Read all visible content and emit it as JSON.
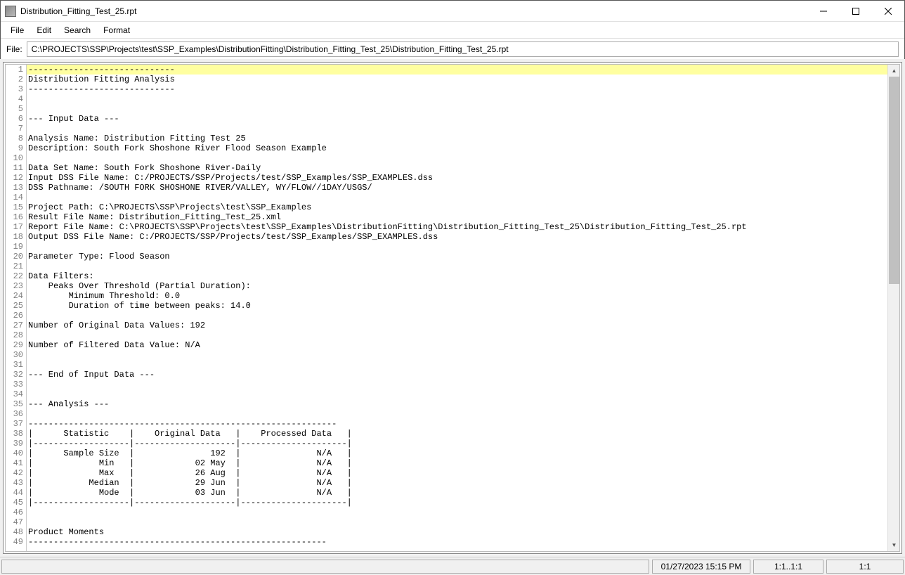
{
  "window": {
    "title": "Distribution_Fitting_Test_25.rpt"
  },
  "menubar": {
    "file": "File",
    "edit": "Edit",
    "search": "Search",
    "format": "Format"
  },
  "filebar": {
    "label": "File:",
    "value": "C:\\PROJECTS\\SSP\\Projects\\test\\SSP_Examples\\DistributionFitting\\Distribution_Fitting_Test_25\\Distribution_Fitting_Test_25.rpt"
  },
  "editor": {
    "lines": [
      "-----------------------------",
      "Distribution Fitting Analysis",
      "-----------------------------",
      "",
      "",
      "--- Input Data ---",
      "",
      "Analysis Name: Distribution Fitting Test 25",
      "Description: South Fork Shoshone River Flood Season Example",
      "",
      "Data Set Name: South Fork Shoshone River-Daily",
      "Input DSS File Name: C:/PROJECTS/SSP/Projects/test/SSP_Examples/SSP_EXAMPLES.dss",
      "DSS Pathname: /SOUTH FORK SHOSHONE RIVER/VALLEY, WY/FLOW//1DAY/USGS/",
      "",
      "Project Path: C:\\PROJECTS\\SSP\\Projects\\test\\SSP_Examples",
      "Result File Name: Distribution_Fitting_Test_25.xml",
      "Report File Name: C:\\PROJECTS\\SSP\\Projects\\test\\SSP_Examples\\DistributionFitting\\Distribution_Fitting_Test_25\\Distribution_Fitting_Test_25.rpt",
      "Output DSS File Name: C:/PROJECTS/SSP/Projects/test/SSP_Examples/SSP_EXAMPLES.dss",
      "",
      "Parameter Type: Flood Season",
      "",
      "Data Filters:",
      "    Peaks Over Threshold (Partial Duration):",
      "        Minimum Threshold: 0.0",
      "        Duration of time between peaks: 14.0",
      "",
      "Number of Original Data Values: 192",
      "",
      "Number of Filtered Data Value: N/A",
      "",
      "",
      "--- End of Input Data ---",
      "",
      "",
      "--- Analysis ---",
      "",
      "-------------------------------------------------------------",
      "|      Statistic    |    Original Data   |    Processed Data   |",
      "|-------------------|--------------------|---------------------|",
      "|      Sample Size  |               192  |               N/A   |",
      "|             Min   |            02 May  |               N/A   |",
      "|             Max   |            26 Aug  |               N/A   |",
      "|           Median  |            29 Jun  |               N/A   |",
      "|             Mode  |            03 Jun  |               N/A   |",
      "|-------------------|--------------------|---------------------|",
      "",
      "",
      "Product Moments",
      "-----------------------------------------------------------"
    ],
    "highlight_line": 0
  },
  "statusbar": {
    "timestamp": "01/27/2023 15:15 PM",
    "selection": "1:1..1:1",
    "position": "1:1"
  }
}
